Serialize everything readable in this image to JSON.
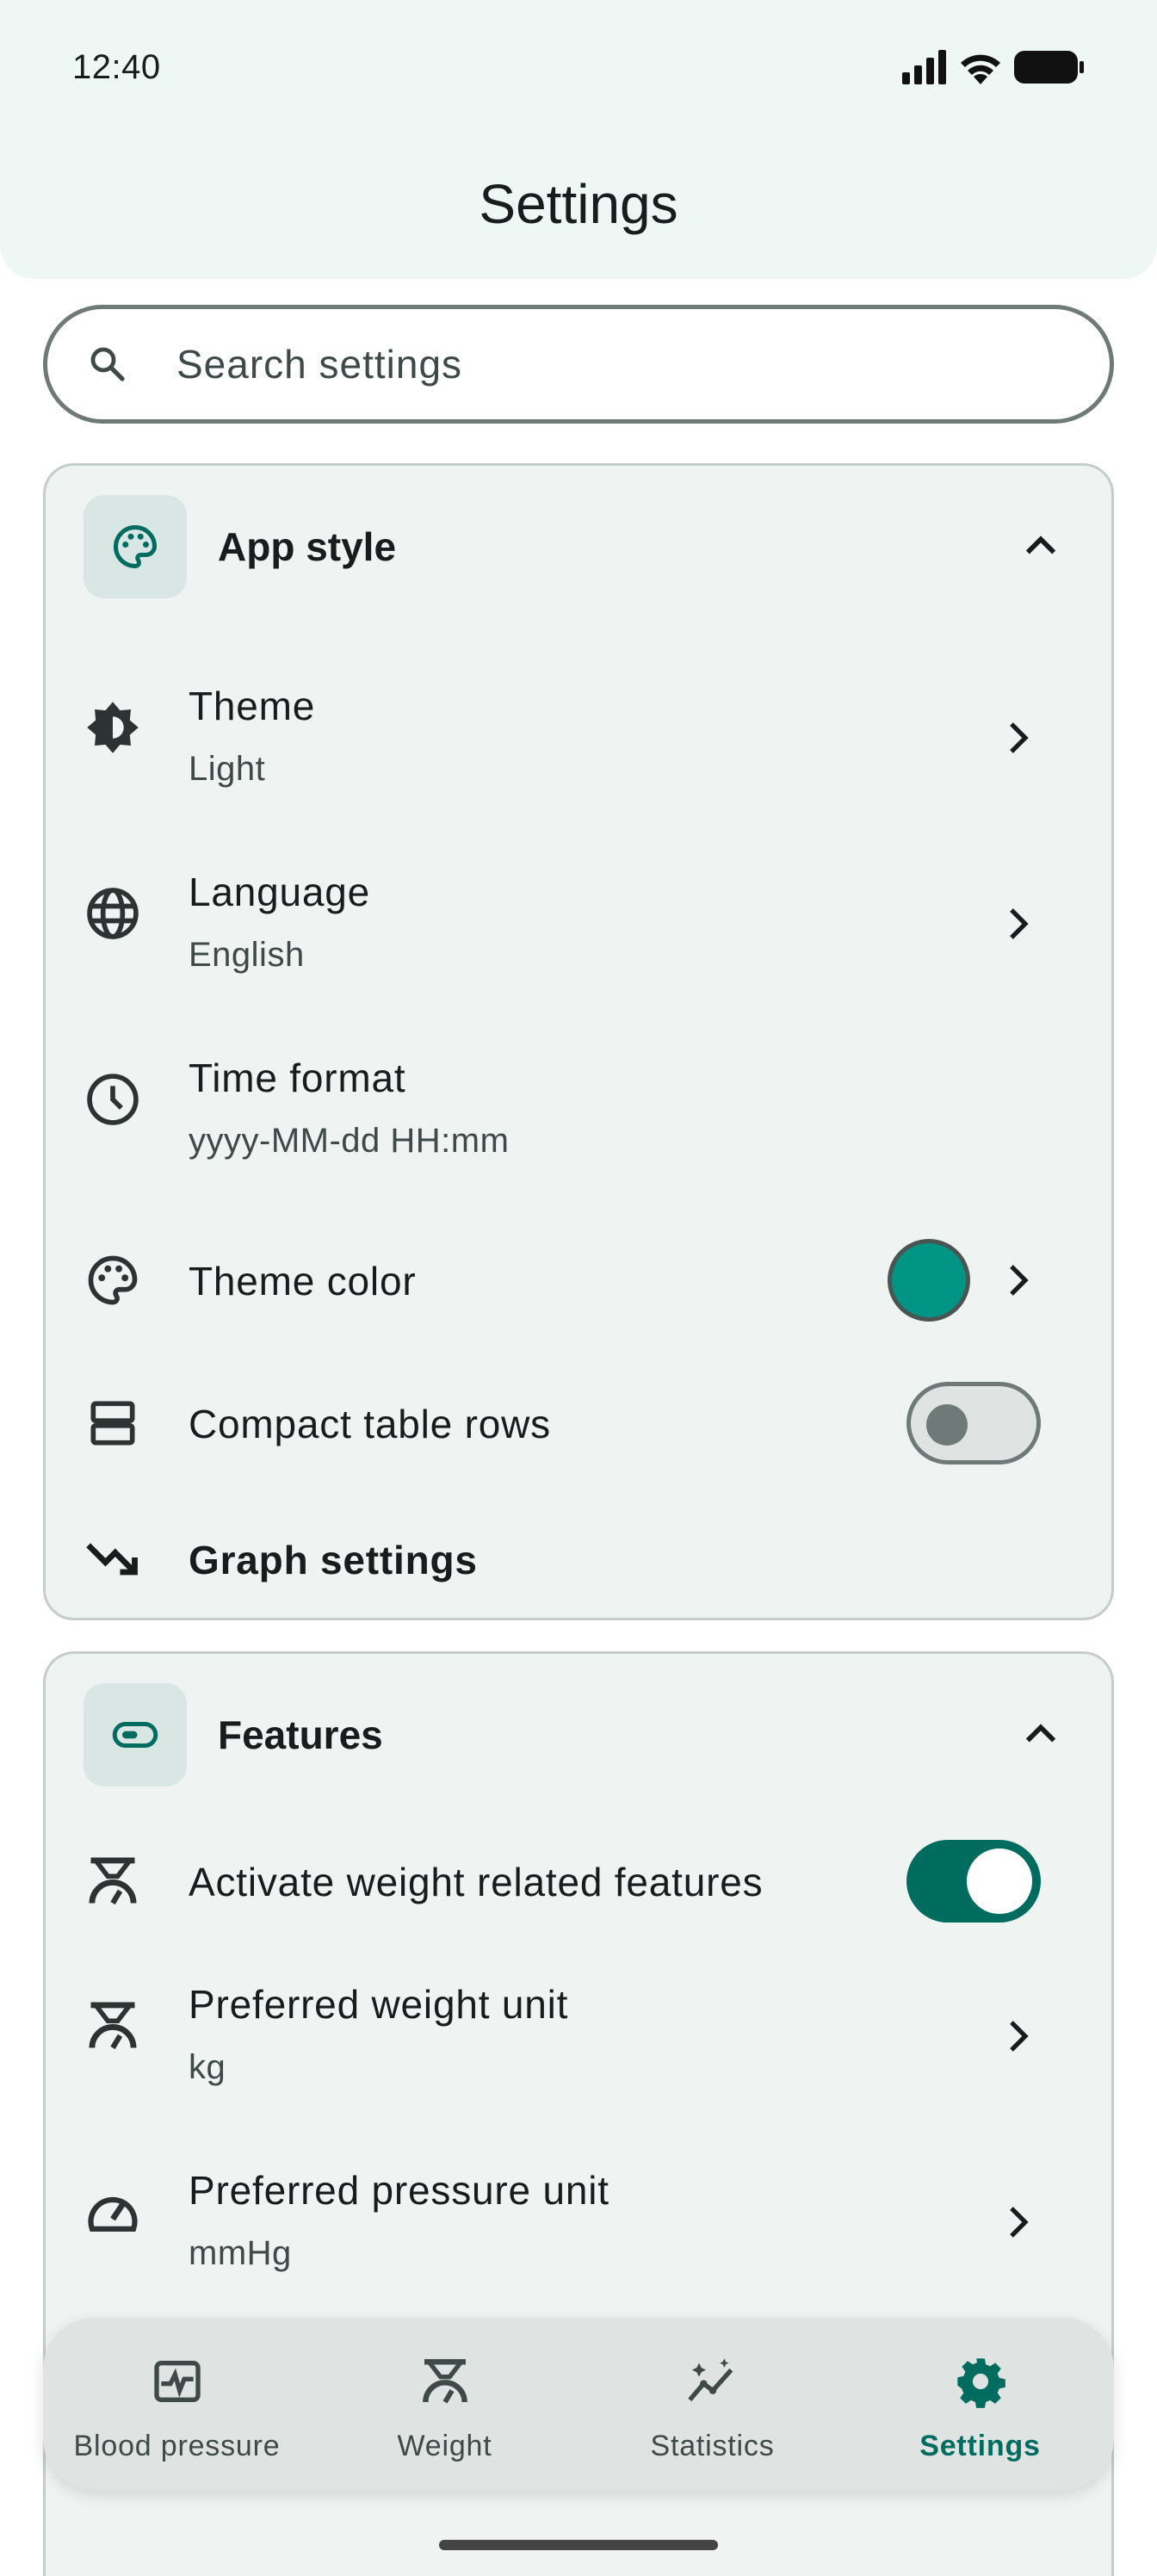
{
  "status_bar": {
    "time": "12:40"
  },
  "header": {
    "title": "Settings"
  },
  "search": {
    "placeholder": "Search settings"
  },
  "colors": {
    "accent": "#006b5f",
    "theme_swatch": "#009485",
    "card_bg": "#eff3f2"
  },
  "app_style": {
    "title": "App style",
    "icon": "palette-icon",
    "theme": {
      "label": "Theme",
      "value": "Light"
    },
    "language": {
      "label": "Language",
      "value": "English"
    },
    "time_format": {
      "label": "Time format",
      "value": "yyyy-MM-dd HH:mm"
    },
    "theme_color": {
      "label": "Theme color"
    },
    "compact_rows": {
      "label": "Compact table rows",
      "enabled": false
    },
    "graph_settings": {
      "label": "Graph settings"
    }
  },
  "features": {
    "title": "Features",
    "icon": "toggle-icon",
    "weight_features": {
      "label": "Activate weight related features",
      "enabled": true
    },
    "weight_unit": {
      "label": "Preferred weight unit",
      "value": "kg"
    },
    "pressure_unit": {
      "label": "Preferred pressure unit",
      "value": "mmHg"
    }
  },
  "nav": {
    "items": [
      {
        "label": "Blood pressure",
        "icon": "heart-pulse-icon"
      },
      {
        "label": "Weight",
        "icon": "scale-icon"
      },
      {
        "label": "Statistics",
        "icon": "chart-icon"
      },
      {
        "label": "Settings",
        "icon": "gear-icon",
        "active": true
      }
    ]
  }
}
